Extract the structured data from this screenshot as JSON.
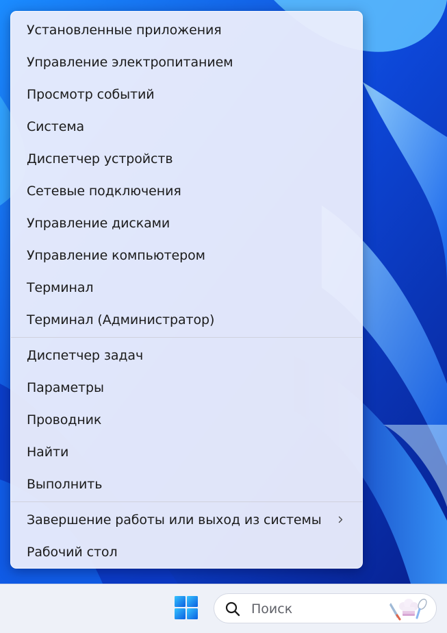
{
  "menu": {
    "group1": [
      {
        "label": "Установленные приложения"
      },
      {
        "label": "Управление электропитанием"
      },
      {
        "label": "Просмотр событий"
      },
      {
        "label": "Система"
      },
      {
        "label": "Диспетчер устройств"
      },
      {
        "label": "Сетевые подключения"
      },
      {
        "label": "Управление дисками"
      },
      {
        "label": "Управление компьютером"
      },
      {
        "label": "Терминал"
      },
      {
        "label": "Терминал (Администратор)"
      }
    ],
    "group2": [
      {
        "label": "Диспетчер задач"
      },
      {
        "label": "Параметры"
      },
      {
        "label": "Проводник"
      },
      {
        "label": "Найти"
      },
      {
        "label": "Выполнить"
      }
    ],
    "group3": [
      {
        "label": "Завершение работы или выход из системы",
        "has_submenu": true
      },
      {
        "label": "Рабочий стол"
      }
    ]
  },
  "taskbar": {
    "search_placeholder": "Поиск",
    "start_icon": "windows-logo-icon",
    "search_icon": "magnifier-icon",
    "highlight_icon": "chef-hat-utensils-icon"
  },
  "colors": {
    "accent": "#0a5fe0",
    "menu_bg": "#eceefc",
    "wallpaper": "#0b3fd0"
  }
}
